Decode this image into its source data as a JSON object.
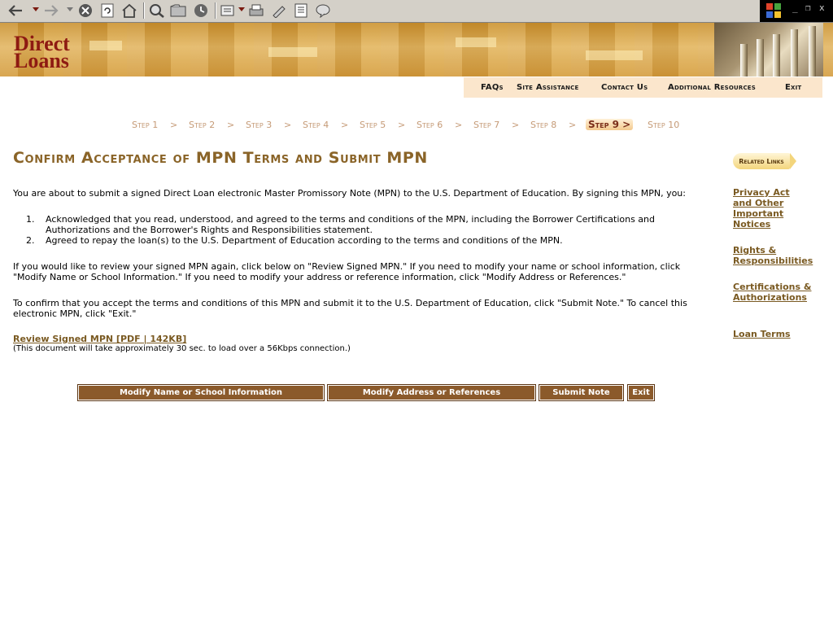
{
  "site": {
    "logo_line1": "Direct",
    "logo_line2": "Loans"
  },
  "sitenav": {
    "faqs": "FAQs",
    "site_assistance": "Site Assistance",
    "contact_us": "Contact Us",
    "additional_resources": "Additional Resources",
    "exit": "Exit"
  },
  "steps": [
    {
      "label": "Step 1"
    },
    {
      "label": "Step 2"
    },
    {
      "label": "Step 3"
    },
    {
      "label": "Step 4"
    },
    {
      "label": "Step 5"
    },
    {
      "label": "Step 6"
    },
    {
      "label": "Step 7"
    },
    {
      "label": "Step 8"
    },
    {
      "label": "Step 9 >"
    },
    {
      "label": "Step 10"
    }
  ],
  "step_separator": ">",
  "main": {
    "title": "Confirm Acceptance of MPN Terms and Submit MPN",
    "intro": "You are about to submit a signed Direct Loan electronic Master Promissory Note (MPN) to the U.S. Department of Education. By signing this MPN, you:",
    "list": [
      {
        "num": "1.",
        "text": "Acknowledged that you read, understood, and agreed to the terms and conditions of the MPN, including the Borrower Certifications and Authorizations and the Borrower's Rights and Responsibilities statement."
      },
      {
        "num": "2.",
        "text": "Agreed to repay the loan(s) to the U.S. Department of Education according to the terms and conditions of the MPN."
      }
    ],
    "review_para": "If you would like to review your signed MPN again, click below on \"Review Signed MPN.\" If you need to modify your name or school information, click \"Modify Name or School Information.\" If you need to modify your address or reference information, click \"Modify Address or References.\"",
    "confirm_para": "To confirm that you accept the terms and conditions of this MPN and submit it to the U.S. Department of Education, click \"Submit Note.\" To cancel this electronic MPN, click \"Exit.\"",
    "pdf_link": "Review Signed MPN [PDF | 142KB]",
    "pdf_note": "(This document will take approximately 30 sec. to load over a 56Kbps connection.)"
  },
  "buttons": {
    "modify_name": "Modify Name or School Information",
    "modify_address": "Modify Address or References",
    "submit": "Submit Note",
    "exit": "Exit"
  },
  "related": {
    "badge": "Related Links",
    "links": [
      "Privacy Act and Other Important Notices",
      "Rights & Responsibilities",
      "Certifications & Authorizations",
      "Loan Terms"
    ]
  },
  "colors": {
    "accent_brown": "#8b5a2b",
    "title_gold": "#8a6428",
    "logo_red": "#8e1a12"
  }
}
